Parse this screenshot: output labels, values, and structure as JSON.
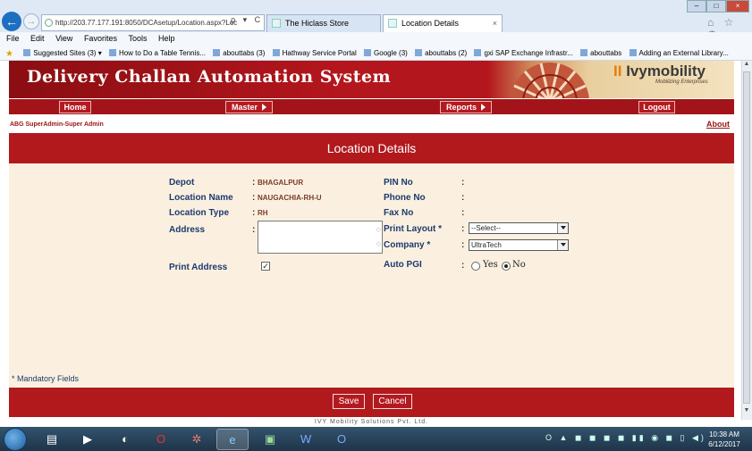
{
  "browser": {
    "address": "http://203.77.177.191:8050/DCAsetup/Location.aspx?Loc",
    "address_tools": "ρ ▾ C",
    "tabs": [
      {
        "label": "The Hiclass Store"
      },
      {
        "label": "Location Details",
        "close": "×"
      }
    ],
    "window_controls": [
      "–",
      "□",
      "×"
    ],
    "right_icons": "⌂ ☆ ⚙",
    "menu": [
      "File",
      "Edit",
      "View",
      "Favorites",
      "Tools",
      "Help"
    ],
    "favorites": [
      "Suggested Sites (3) ▾",
      "How to Do a Table Tennis...",
      "abouttabs (3)",
      "Hathway Service Portal",
      "Google (3)",
      "abouttabs (2)",
      "gxi SAP Exchange Infrastr...",
      "abouttabs",
      "Adding an External Library..."
    ]
  },
  "header": {
    "title": "Delivery Challan Automation System",
    "logo_text": "Ivymobility",
    "logo_mark": "II",
    "logo_tagline": "Mobilizing Enterprises"
  },
  "nav": {
    "home": "Home",
    "master": "Master",
    "reports": "Reports",
    "logout": "Logout"
  },
  "user": {
    "info": "ABG SuperAdmin-Super Admin",
    "about": "About"
  },
  "panel": {
    "title": "Location Details"
  },
  "form": {
    "colon": ":",
    "depot_label": "Depot",
    "depot_value": "BHAGALPUR",
    "location_name_label": "Location Name",
    "location_name_value": "NAUGACHIA-RH-U",
    "location_type_label": "Location Type",
    "location_type_value": "RH",
    "address_label": "Address",
    "address_value": "",
    "print_address_label": "Print Address",
    "print_address_checked": true,
    "checkmark": "✓",
    "pin_label": "PIN No",
    "phone_label": "Phone No",
    "fax_label": "Fax No",
    "print_layout_label": "Print Layout *",
    "print_layout_value": "--Select--",
    "company_label": "Company *",
    "company_value": "UltraTech",
    "auto_pgi_label": "Auto PGI",
    "auto_pgi_yes": "Yes",
    "auto_pgi_no": "No",
    "auto_pgi_selected": "No"
  },
  "mandatory_note": "* Mandatory Fields",
  "buttons": {
    "save": "Save",
    "cancel": "Cancel"
  },
  "copyright": "IVY Mobility Solutions Pvt. Ltd.",
  "taskbar": {
    "tray": "O ▲ ◼ ◼ ◼ ◼ ▮▮ ◉ ◼ ▯ ◀)",
    "time": "10:38 AM",
    "date": "6/12/2017"
  },
  "colors": {
    "brand_red": "#b1191d",
    "panel_bg": "#fbf0df",
    "label_blue": "#1c3a6e"
  }
}
